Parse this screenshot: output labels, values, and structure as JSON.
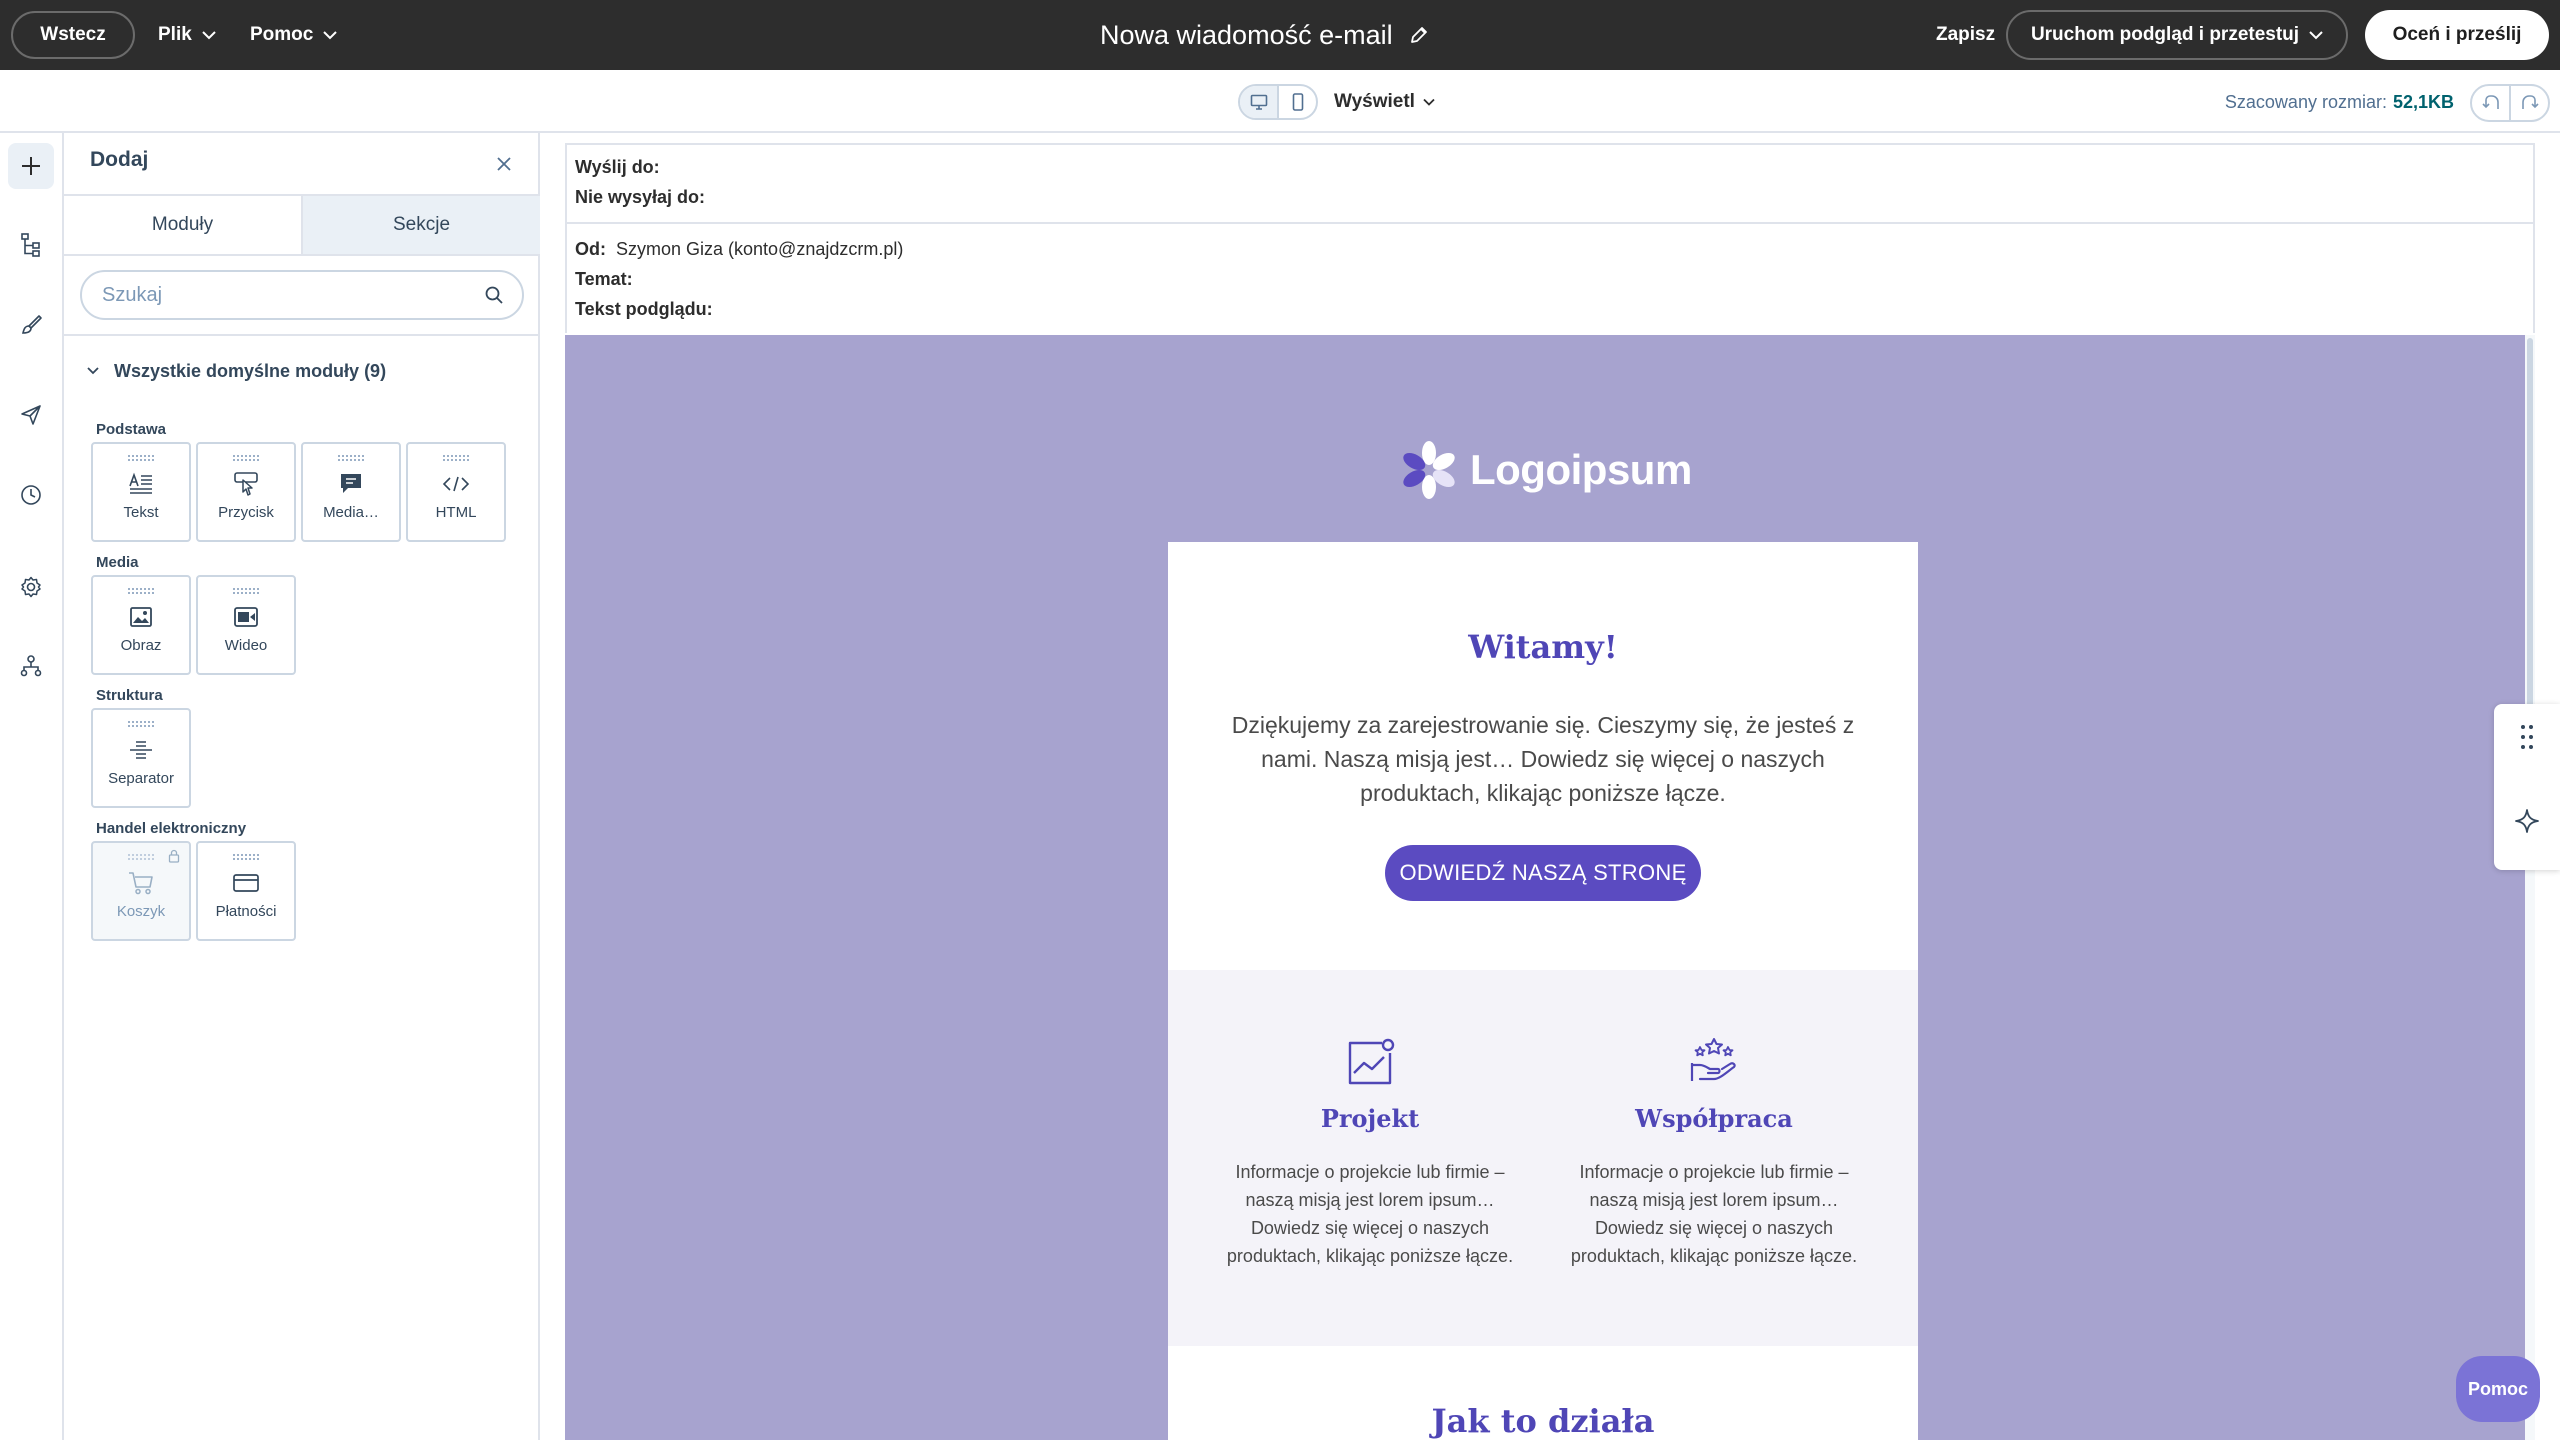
{
  "topbar": {
    "back_label": "Wstecz",
    "menu_file": "Plik",
    "menu_help": "Pomoc",
    "email_title": "Nowa wiadomość e-mail",
    "save_label": "Zapisz",
    "preview_label": "Uruchom podgląd i przetestuj",
    "review_label": "Oceń i prześlij"
  },
  "toolbar": {
    "view_label": "Wyświetl",
    "size_label": "Szacowany rozmiar:",
    "size_value": "52,1KB"
  },
  "panel": {
    "title": "Dodaj",
    "tabs": [
      "Moduły",
      "Sekcje"
    ],
    "search_placeholder": "Szukaj",
    "group_label": "Wszystkie domyślne moduły (9)",
    "categories": {
      "basic": "Podstawa",
      "media": "Media",
      "structure": "Struktura",
      "commerce": "Handel elektroniczny"
    },
    "modules": {
      "text": "Tekst",
      "button": "Przycisk",
      "media_text": "Media…",
      "html": "HTML",
      "image": "Obraz",
      "video": "Wideo",
      "separator": "Separator",
      "cart": "Koszyk",
      "payments": "Płatności"
    }
  },
  "email_header": {
    "send_to_label": "Wyślij do:",
    "dont_send_label": "Nie wysyłaj do:",
    "from_label": "Od:",
    "from_value": "Szymon Giza (konto@znajdzcrm.pl)",
    "subject_label": "Temat:",
    "preview_text_label": "Tekst podglądu:"
  },
  "email": {
    "logo_text": "Logoipsum",
    "welcome_title": "Witamy!",
    "intro_text": "Dziękujemy za zarejestrowanie się. Cieszymy się, że jesteś z nami. Naszą misją jest… Dowiedz się więcej o naszych produktach, klikając poniższe łącze.",
    "cta_label": "ODWIEDŹ NASZĄ STRONĘ",
    "features": [
      {
        "title": "Projekt",
        "text": "Informacje o projekcie lub firmie – naszą misją jest lorem ipsum… Dowiedz się więcej o naszych produktach, klikając poniższe łącze."
      },
      {
        "title": "Współpraca",
        "text": "Informacje o projekcie lub firmie – naszą misją jest lorem ipsum… Dowiedz się więcej o naszych produktach, klikając poniższe łącze."
      }
    ],
    "how_title": "Jak to działa"
  },
  "help_button": "Pomoc",
  "colors": {
    "topbar_bg": "#2d2d2d",
    "canvas_bg": "#a7a3cf",
    "brand_purple": "#4f46b6",
    "cta_bg": "#5b4bc1",
    "help_bg": "#7b73d6",
    "size_value": "#00626e"
  }
}
